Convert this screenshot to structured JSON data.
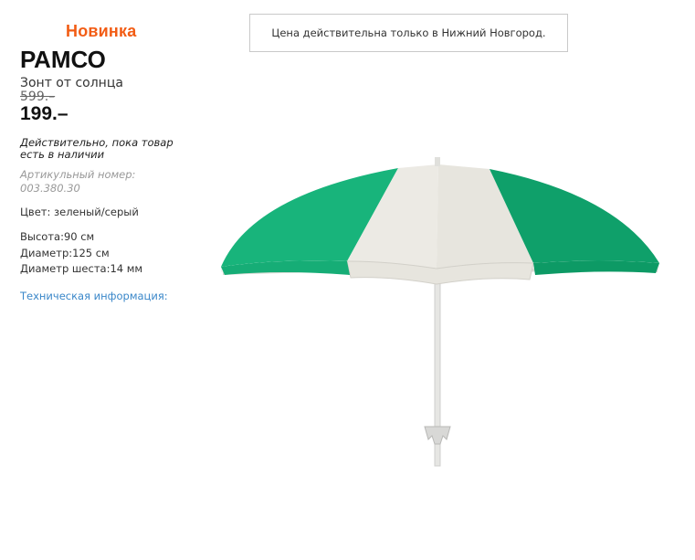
{
  "badge": {
    "label": "Новинка"
  },
  "product": {
    "name": "РАМСО",
    "description": "Зонт от солнца",
    "old_price": "599.–",
    "new_price": "199.–",
    "availability": "Действительно, пока товар есть в наличии",
    "article_label": "Артикульный номер:",
    "article_number": "003.380.30",
    "color": "Цвет: зеленый/серый",
    "specs": [
      "Высота:90 см",
      "Диаметр:125 см",
      "Диаметр шеста:14 мм"
    ],
    "tech_link": "Техническая информация:"
  },
  "notice": {
    "text": "Цена действительна только в Нижний Новгород."
  },
  "colors": {
    "accent": "#f25c14",
    "link": "#3a87c9",
    "umbrella_green": "#17b37a",
    "umbrella_grey": "#ecebe6"
  }
}
